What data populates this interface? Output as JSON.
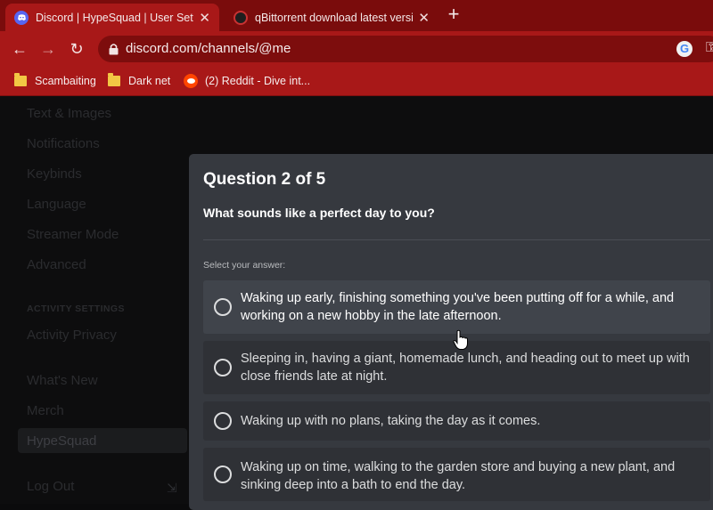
{
  "browser": {
    "tabs": [
      {
        "title": "Discord | HypeSquad | User Settings",
        "active": true
      },
      {
        "title": "qBittorrent download latest version",
        "active": false
      }
    ],
    "url": "discord.com/channels/@me",
    "bookmarks": [
      {
        "label": "Scambaiting",
        "icon": "folder-icon"
      },
      {
        "label": "Dark net",
        "icon": "folder-icon"
      },
      {
        "label": "(2) Reddit - Dive int...",
        "icon": "reddit-icon"
      }
    ]
  },
  "settings_sidebar": {
    "items": [
      "Text & Images",
      "Notifications",
      "Keybinds",
      "Language",
      "Streamer Mode",
      "Advanced"
    ],
    "activity_header": "ACTIVITY SETTINGS",
    "activity_items": [
      "Activity Privacy"
    ],
    "misc_items": [
      "What's New",
      "Merch",
      "HypeSquad"
    ],
    "logout": "Log Out"
  },
  "quiz": {
    "title": "Question 2 of 5",
    "question": "What sounds like a perfect day to you?",
    "select_label": "Select your answer:",
    "options": [
      "Waking up early, finishing something you've been putting off for a while, and working on a new hobby in the late afternoon.",
      "Sleeping in, having a giant, homemade lunch, and heading out to meet up with close friends late at night.",
      "Waking up with no plans, taking the day as it comes.",
      "Waking up on time, walking to the garden store and buying a new plant, and sinking deep into a bath to end the day."
    ]
  },
  "colors": {
    "chrome_red": "#a81818",
    "modal_bg": "#36393f",
    "option_bg": "#2f3136",
    "discord_blurple": "#5865f2"
  }
}
